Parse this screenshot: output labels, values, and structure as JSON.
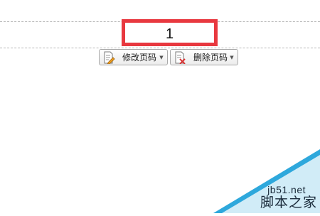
{
  "header": {
    "page_number": "1"
  },
  "toolbar": {
    "edit_page_number_label": "修改页码",
    "delete_page_number_label": "删除页码"
  },
  "watermark": {
    "site": "jb51.net",
    "name": "脚本之家",
    "color": "#2ea8dc"
  },
  "highlight_color": "#e8383f"
}
